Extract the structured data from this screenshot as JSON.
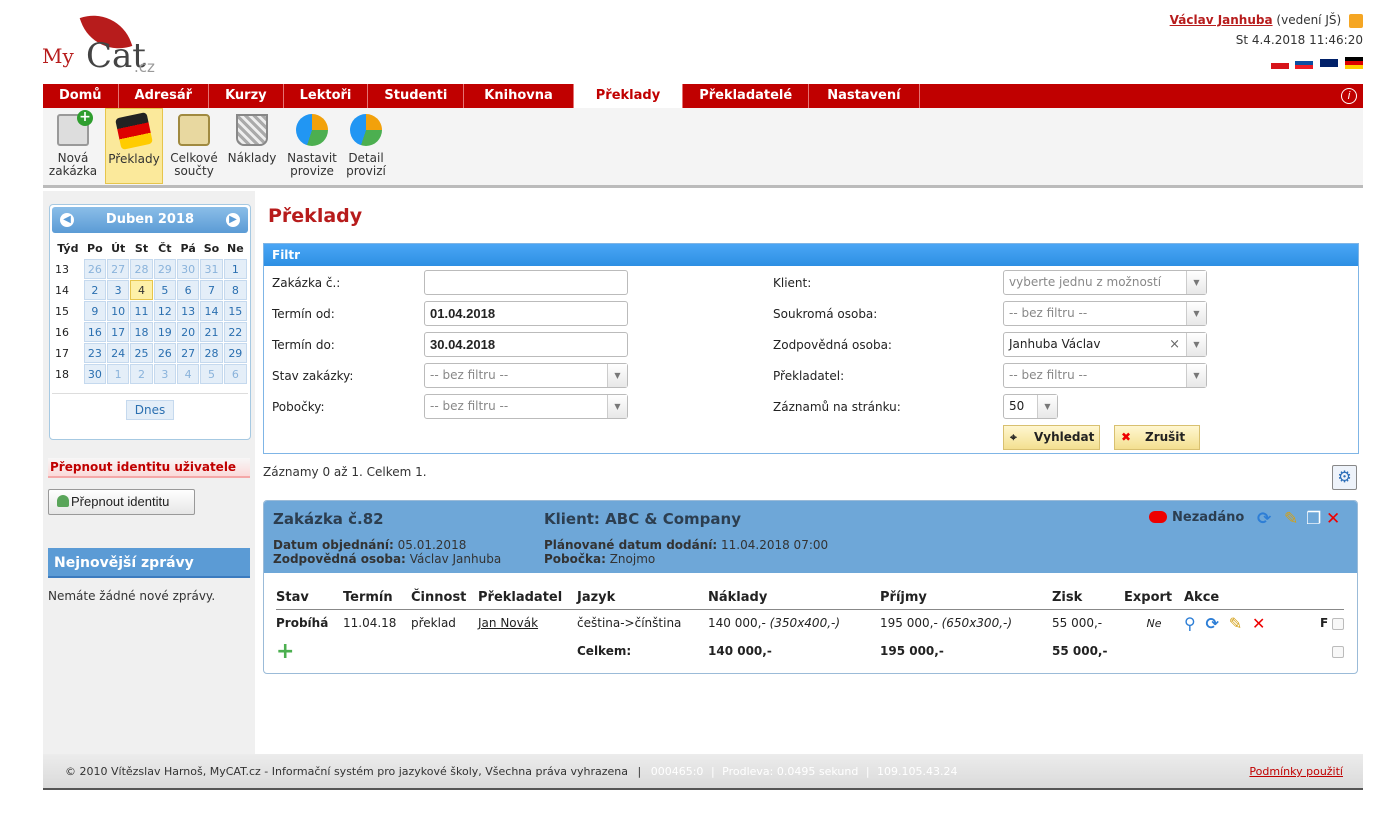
{
  "header": {
    "logo_my": "My",
    "logo_cat": "Cat",
    "logo_cz": ".cz",
    "user_name": "Václav Janhuba",
    "user_role": "(vedení JŠ)",
    "datetime": "St 4.4.2018 11:46:20"
  },
  "nav": {
    "tabs": [
      "Domů",
      "Adresář",
      "Kurzy",
      "Lektoři",
      "Studenti",
      "Knihovna",
      "Překlady",
      "Překladatelé",
      "Nastavení"
    ],
    "active": "Překlady",
    "info_glyph": "i"
  },
  "toolbar": {
    "items": [
      {
        "line1": "Nová",
        "line2": "zakázka",
        "icon": "new-order-icon"
      },
      {
        "line1": "Překlady",
        "line2": "",
        "icon": "flag-icon"
      },
      {
        "line1": "Celkové",
        "line2": "součty",
        "icon": "calculator-icon"
      },
      {
        "line1": "Náklady",
        "line2": "",
        "icon": "basket-icon"
      },
      {
        "line1": "Nastavit",
        "line2": "provize",
        "icon": "pie-chart-icon"
      },
      {
        "line1": "Detail",
        "line2": "provizí",
        "icon": "pie-chart-icon"
      }
    ]
  },
  "calendar": {
    "month": "Duben 2018",
    "headers": [
      "Týd",
      "Po",
      "Út",
      "St",
      "Čt",
      "Pá",
      "So",
      "Ne"
    ],
    "weeks": [
      {
        "wk": "13",
        "days": [
          "26",
          "27",
          "28",
          "29",
          "30",
          "31",
          "1"
        ],
        "other": [
          true,
          true,
          true,
          true,
          true,
          true,
          false
        ]
      },
      {
        "wk": "14",
        "days": [
          "2",
          "3",
          "4",
          "5",
          "6",
          "7",
          "8"
        ],
        "other": [
          false,
          false,
          false,
          false,
          false,
          false,
          false
        ]
      },
      {
        "wk": "15",
        "days": [
          "9",
          "10",
          "11",
          "12",
          "13",
          "14",
          "15"
        ],
        "other": [
          false,
          false,
          false,
          false,
          false,
          false,
          false
        ]
      },
      {
        "wk": "16",
        "days": [
          "16",
          "17",
          "18",
          "19",
          "20",
          "21",
          "22"
        ],
        "other": [
          false,
          false,
          false,
          false,
          false,
          false,
          false
        ]
      },
      {
        "wk": "17",
        "days": [
          "23",
          "24",
          "25",
          "26",
          "27",
          "28",
          "29"
        ],
        "other": [
          false,
          false,
          false,
          false,
          false,
          false,
          false
        ]
      },
      {
        "wk": "18",
        "days": [
          "30",
          "1",
          "2",
          "3",
          "4",
          "5",
          "6"
        ],
        "other": [
          false,
          true,
          true,
          true,
          true,
          true,
          true
        ]
      }
    ],
    "today": "4",
    "today_button": "Dnes"
  },
  "sidebar": {
    "switch_title": "Přepnout identitu uživatele",
    "switch_button": "Přepnout identitu",
    "news_title": "Nejnovější zprávy",
    "news_text": "Nemáte žádné nové zprávy."
  },
  "page_title": "Překlady",
  "filter": {
    "title": "Filtr",
    "order_no_label": "Zakázka č.:",
    "order_no_value": "",
    "date_from_label": "Termín od:",
    "date_from_value": "01.04.2018",
    "date_to_label": "Termín do:",
    "date_to_value": "30.04.2018",
    "status_label": "Stav zakázky:",
    "status_value": "-- bez filtru --",
    "branches_label": "Pobočky:",
    "branches_value": "-- bez filtru --",
    "client_label": "Klient:",
    "client_value": "vyberte jednu z možností",
    "private_label": "Soukromá osoba:",
    "private_value": "-- bez filtru --",
    "responsible_label": "Zodpovědná osoba:",
    "responsible_value": "Janhuba Václav",
    "translator_label": "Překladatel:",
    "translator_value": "-- bez filtru --",
    "per_page_label": "Záznamů na stránku:",
    "per_page_value": "50",
    "search_button": "Vyhledat",
    "cancel_button": "Zrušit"
  },
  "records_info": "Záznamy 0 až 1. Celkem 1.",
  "order": {
    "title": "Zakázka č.82",
    "client": "Klient: ABC & Company",
    "ordered_label": "Datum objednání:",
    "ordered_value": "05.01.2018",
    "responsible_label": "Zodpovědná osoba:",
    "responsible_value": "Václav Janhuba",
    "planned_label": "Plánované datum dodání:",
    "planned_value": "11.04.2018 07:00",
    "branch_label": "Pobočka:",
    "branch_value": "Znojmo",
    "status": "Nezadáno",
    "columns": [
      "Stav",
      "Termín",
      "Činnost",
      "Překladatel",
      "Jazyk",
      "Náklady",
      "Příjmy",
      "Zisk",
      "Export",
      "Akce"
    ],
    "row": {
      "stav": "Probíhá",
      "termin": "11.04.18",
      "cinnost": "překlad",
      "prekladatel": "Jan Novák",
      "jazyk": "čeština->čínština",
      "naklady": "140 000,-",
      "naklady_detail": "(350x400,-)",
      "prijmy": "195 000,-",
      "prijmy_detail": "(650x300,-)",
      "zisk": "55 000,-",
      "export": "Ne",
      "f": "F"
    },
    "total": {
      "label": "Celkem:",
      "naklady": "140 000,-",
      "prijmy": "195 000,-",
      "zisk": "55 000,-"
    }
  },
  "footer": {
    "copyright": "© 2010 Vítězslav Harnoš, MyCAT.cz - Informační systém pro jazykové školy, Všechna práva vyhrazena",
    "sep": "|",
    "code": "000465:0",
    "delay": "Prodleva: 0.0495 sekund",
    "ip": "109.105.43.24",
    "terms": "Podmínky použití"
  },
  "colors": {
    "brand_red": "#c00000",
    "accent_blue": "#5b9bd5"
  }
}
